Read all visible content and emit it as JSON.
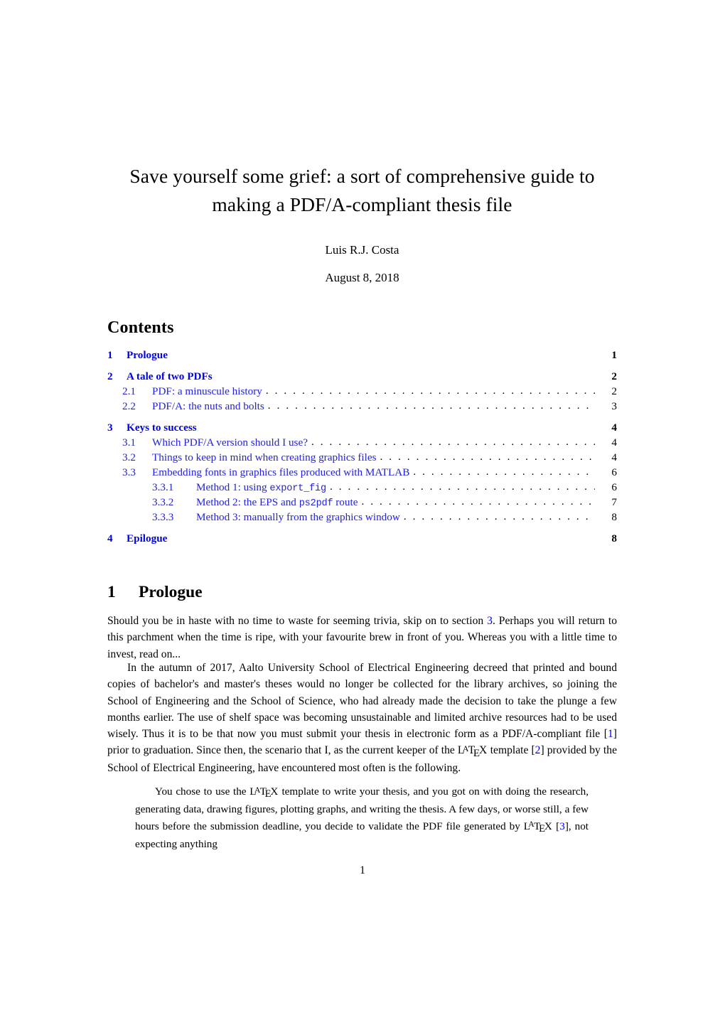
{
  "document": {
    "title": "Save yourself some grief: a sort of comprehensive guide to making a PDF/A-compliant thesis file",
    "title_line1": "Save yourself some grief: a sort of comprehensive guide to",
    "title_line2": "making a PDF/A-compliant thesis file",
    "author": "Luis R.J. Costa",
    "date": "August 8, 2018",
    "page_number": "1",
    "link_color": "#0000ee",
    "text_color": "#000000"
  },
  "contents": {
    "heading": "Contents",
    "entries": [
      {
        "level": 1,
        "number": "1",
        "text": "Prologue",
        "page": "1"
      },
      {
        "level": 1,
        "number": "2",
        "text": "A tale of two PDFs",
        "page": "2"
      },
      {
        "level": 2,
        "number": "2.1",
        "text": "PDF: a minuscule history",
        "page": "2"
      },
      {
        "level": 2,
        "number": "2.2",
        "text": "PDF/A: the nuts and bolts",
        "page": "3"
      },
      {
        "level": 1,
        "number": "3",
        "text": "Keys to success",
        "page": "4"
      },
      {
        "level": 2,
        "number": "3.1",
        "text": "Which PDF/A version should I use?",
        "page": "4"
      },
      {
        "level": 2,
        "number": "3.2",
        "text": "Things to keep in mind when creating graphics files",
        "page": "4"
      },
      {
        "level": 2,
        "number": "3.3",
        "text": "Embedding fonts in graphics files produced with MATLAB",
        "page": "6"
      },
      {
        "level": 3,
        "number": "3.3.1",
        "text_pre": "Method 1: using ",
        "text_mono": "export_fig",
        "text_post": "",
        "page": "6"
      },
      {
        "level": 3,
        "number": "3.3.2",
        "text_pre": "Method 2: the EPS and ",
        "text_mono": "ps2pdf",
        "text_post": " route",
        "page": "7"
      },
      {
        "level": 3,
        "number": "3.3.3",
        "text_pre": "Method 3: manually from the graphics window",
        "text_mono": "",
        "text_post": "",
        "page": "8"
      },
      {
        "level": 1,
        "number": "4",
        "text": "Epilogue",
        "page": "8"
      }
    ]
  },
  "section": {
    "number": "1",
    "title": "Prologue"
  },
  "paragraph1": {
    "part_a": "Should you be in haste with no time to waste for seeming trivia, skip on to section ",
    "ref": "3",
    "part_b": ". Perhaps you will return to this parchment when the time is ripe, with your favourite brew in front of you. Whereas you with a little time to invest, read on..."
  },
  "paragraph2": {
    "part_a": "In the autumn of 2017, Aalto University School of Electrical Engineering decreed that printed and bound copies of bachelor's and master's theses would no longer be collected for the library archives, so joining the School of Engineering and the School of Science, who had already made the decision to take the plunge a few months earlier. The use of shelf space was becoming unsustainable and limited archive resources had to be used wisely. Thus it is to be that now you must submit your thesis in electronic form as a PDF/A-compliant file [",
    "cite1": "1",
    "part_b": "] prior to graduation. Since then, the scenario that I, as the current keeper of the ",
    "latex": "LaTeX",
    "part_c": " template [",
    "cite2": "2",
    "part_d": "] provided by the School of Electrical Engineering, have encountered most often is the following."
  },
  "quote": {
    "part_a": "You chose to use the ",
    "latex1": "LaTeX",
    "part_b": " template to write your thesis, and you got on with doing the research, generating data, drawing figures, plotting graphs, and writing the thesis. A few days, or worse still, a few hours before the submission deadline, you decide to validate the PDF file generated by ",
    "latex2": "LaTeX",
    "part_c": " [",
    "cite3": "3",
    "part_d": "], not expecting anything"
  }
}
